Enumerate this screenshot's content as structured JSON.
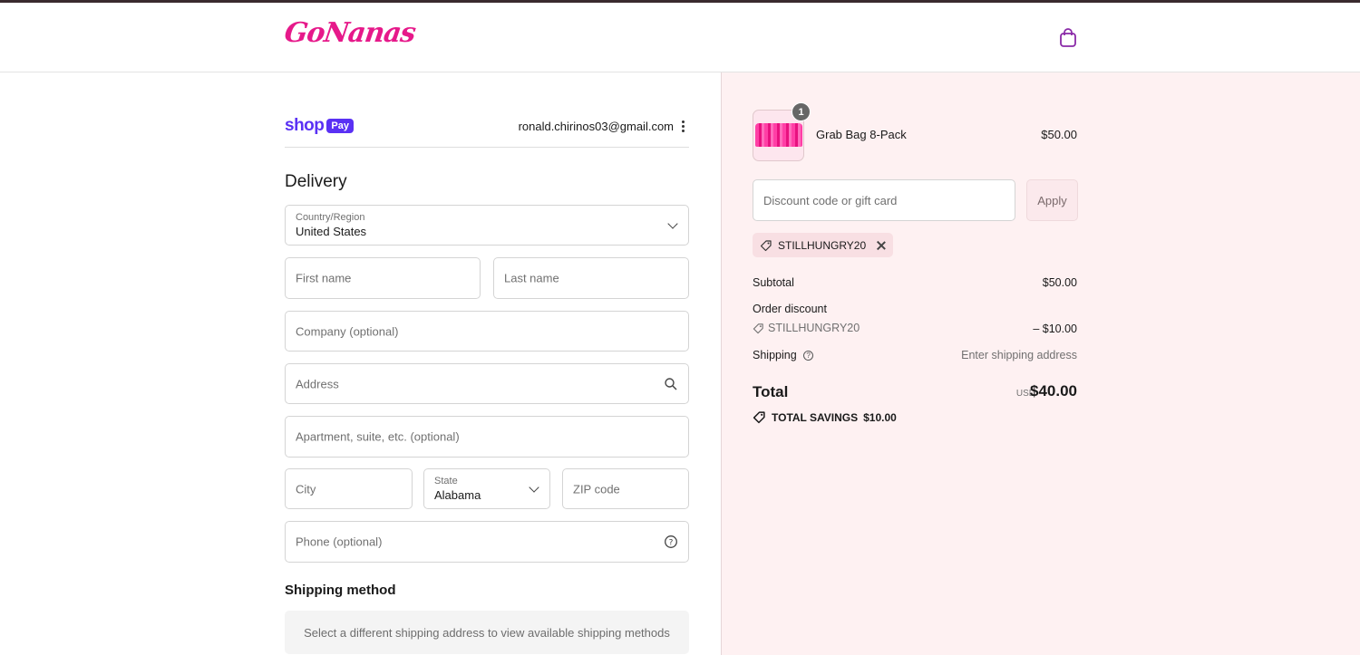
{
  "header": {
    "logo_text": "GoNanas",
    "cart_icon": "shopping-bag-icon"
  },
  "account": {
    "shop_word": "shop",
    "pay_badge": "Pay",
    "email": "ronald.chirinos03@gmail.com",
    "menu_icon": "kebab-menu-icon"
  },
  "delivery": {
    "heading": "Delivery",
    "country_label": "Country/Region",
    "country_value": "United States",
    "first_name_placeholder": "First name",
    "last_name_placeholder": "Last name",
    "company_placeholder": "Company (optional)",
    "address_placeholder": "Address",
    "apartment_placeholder": "Apartment, suite, etc. (optional)",
    "city_placeholder": "City",
    "state_label": "State",
    "state_value": "Alabama",
    "zip_placeholder": "ZIP code",
    "phone_placeholder": "Phone (optional)"
  },
  "shipping_method": {
    "heading": "Shipping method",
    "notice": "Select a different shipping address to view available shipping methods"
  },
  "order_summary": {
    "item": {
      "name": "Grab Bag 8-Pack",
      "price": "$50.00",
      "quantity": "1"
    },
    "discount_placeholder": "Discount code or gift card",
    "apply_label": "Apply",
    "applied_code": "STILLHUNGRY20",
    "subtotal_label": "Subtotal",
    "subtotal_value": "$50.00",
    "order_discount_label": "Order discount",
    "order_discount_code": "STILLHUNGRY20",
    "order_discount_value": "– $10.00",
    "shipping_label": "Shipping",
    "shipping_value": "Enter shipping address",
    "total_label": "Total",
    "total_currency": "USD",
    "total_value": "$40.00",
    "savings_label": "TOTAL SAVINGS",
    "savings_value": "$10.00"
  },
  "colors": {
    "brand_pink": "#e6198a",
    "shop_pay_purple": "#5a31f4",
    "summary_bg": "#fef1f2"
  }
}
